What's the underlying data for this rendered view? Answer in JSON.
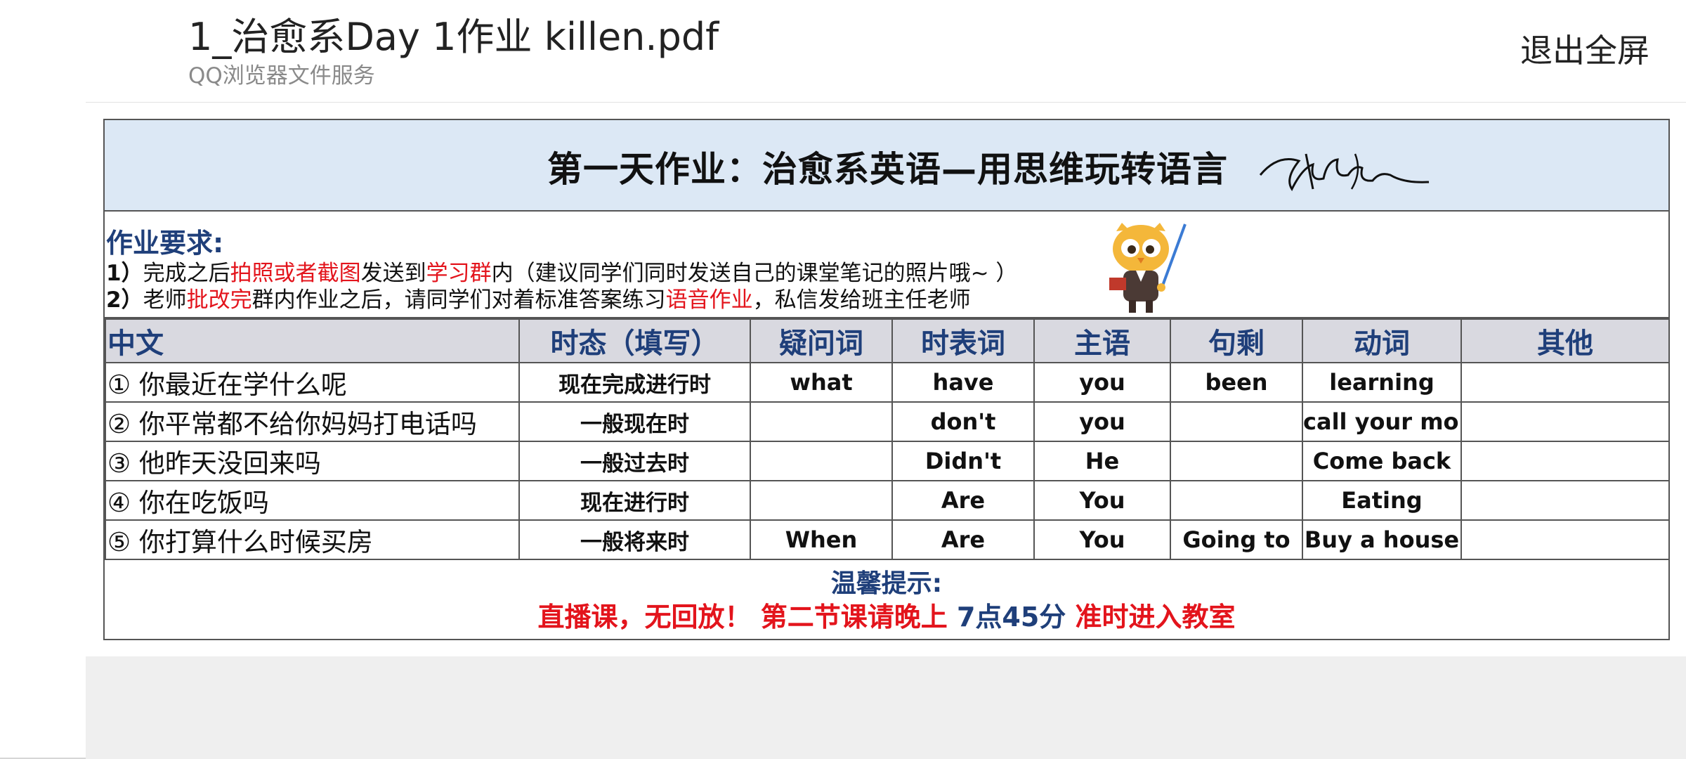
{
  "header": {
    "title": "1_治愈系Day 1作业 killen.pdf",
    "subtitle": "QQ浏览器文件服务",
    "exit_label": "退出全屏"
  },
  "sheet": {
    "title": "第一天作业：治愈系英语—用思维玩转语言",
    "requirements": {
      "heading": "作业要求:",
      "line1": {
        "num": "1）",
        "p1": "完成之后",
        "r1": "拍照或者截图",
        "p2": "发送到",
        "r2": "学习群",
        "p3": "内（建议同学们同时发送自己的课堂笔记的照片哦~ ）"
      },
      "line2": {
        "num": "2）",
        "p1": "老师",
        "r1": "批改完",
        "p2": "群内作业之后，请同学们对着标准答案练习",
        "r2": "语音作业",
        "p3": "，私信发给班主任老师"
      }
    },
    "columns": [
      "中文",
      "时态（填写）",
      "疑问词",
      "时表词",
      "主语",
      "句剩",
      "动词",
      "其他"
    ],
    "rows": [
      [
        "① 你最近在学什么呢",
        "现在完成进行时",
        "what",
        "have",
        "you",
        "been",
        "learning",
        ""
      ],
      [
        "② 你平常都不给你妈妈打电话吗",
        "一般现在时",
        "",
        "don't",
        "you",
        "",
        "call your mom",
        ""
      ],
      [
        "③ 他昨天没回来吗",
        "一般过去时",
        "",
        "Didn't",
        "He",
        "",
        "Come back",
        ""
      ],
      [
        "④ 你在吃饭吗",
        "现在进行时",
        "",
        "Are",
        "You",
        "",
        "Eating",
        ""
      ],
      [
        "⑤ 你打算什么时候买房",
        "一般将来时",
        "When",
        "Are",
        "You",
        "Going to",
        "Buy a house",
        ""
      ]
    ],
    "tips": {
      "heading": "温馨提示:",
      "part1": "直播课，无回放！ 第二节课请晚上 ",
      "part2": "7点45分",
      "part3": "  准时进入教室"
    }
  },
  "colors": {
    "accent_blue": "#1f3f7a",
    "highlight_red": "#e3141c",
    "title_band": "#dce8f5",
    "header_row": "#d9d9e0"
  }
}
